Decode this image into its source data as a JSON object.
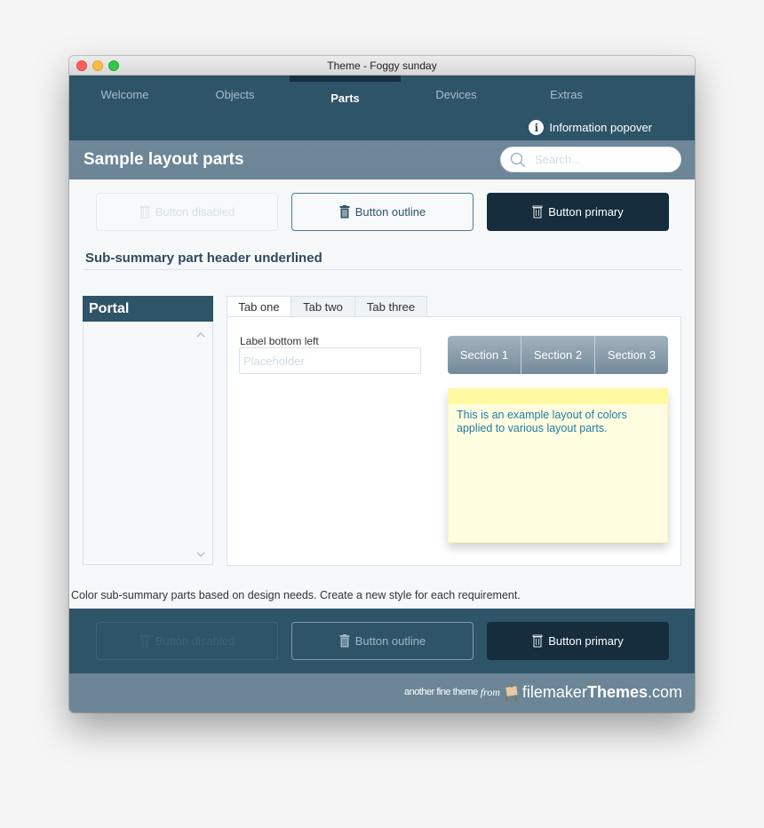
{
  "window": {
    "title": "Theme - Foggy sunday"
  },
  "nav": {
    "items": [
      {
        "label": "Welcome",
        "active": false
      },
      {
        "label": "Objects",
        "active": false
      },
      {
        "label": "Parts",
        "active": true
      },
      {
        "label": "Devices",
        "active": false
      },
      {
        "label": "Extras",
        "active": false
      }
    ],
    "info_label": "Information popover"
  },
  "header": {
    "title": "Sample layout parts",
    "search_placeholder": "Search...",
    "search_value": ""
  },
  "buttons_top": {
    "disabled": "Button disabled",
    "outline": "Button outline",
    "primary": "Button primary"
  },
  "subsummary": {
    "title": "Sub-summary part header underlined"
  },
  "portal": {
    "title": "Portal"
  },
  "tabs": {
    "items": [
      {
        "label": "Tab one",
        "active": true
      },
      {
        "label": "Tab two",
        "active": false
      },
      {
        "label": "Tab three",
        "active": false
      }
    ]
  },
  "form": {
    "label": "Label bottom left",
    "placeholder": "Placeholder",
    "value": ""
  },
  "segmented": {
    "items": [
      "Section 1",
      "Section 2",
      "Section 3"
    ]
  },
  "note": {
    "text": "This is an example layout of colors applied to various layout parts."
  },
  "caption": "Color sub-summary parts based on design needs. Create a new style for each requirement.",
  "buttons_bottom": {
    "disabled": "Button disabled",
    "outline": "Button outline",
    "primary": "Button primary"
  },
  "footer": {
    "prefix": "another fine theme",
    "from": "from",
    "brand_light": "filemaker",
    "brand_bold": "Themes",
    "brand_suffix": ".com"
  },
  "colors": {
    "nav_bg": "#2e5468",
    "header_bg": "#6c8697",
    "primary_button": "#152d3c",
    "note_bg": "#fffde0",
    "note_text": "#1f7ba4"
  }
}
